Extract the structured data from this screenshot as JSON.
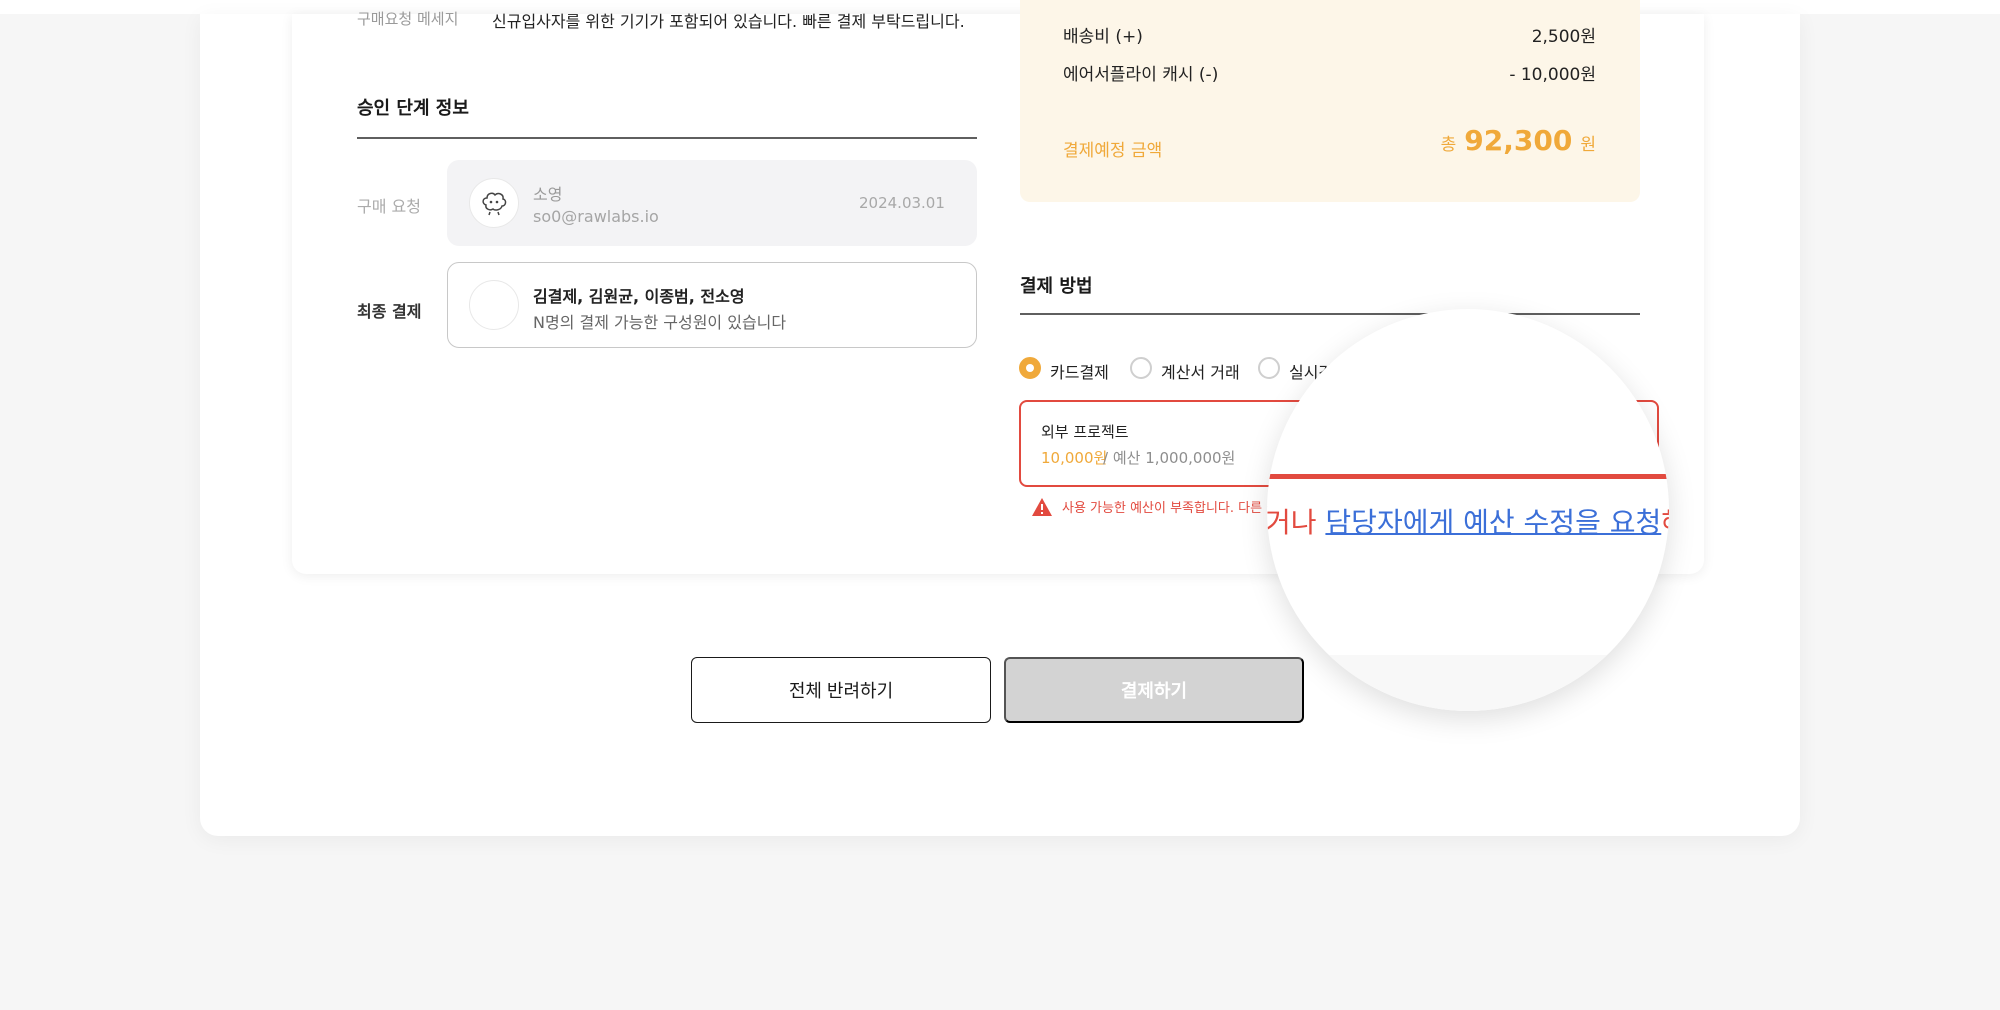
{
  "request_message": {
    "label": "구매요청 메세지",
    "text": "신규입사자를 위한 기기가 포함되어 있습니다. 빠른 결제 부탁드립니다."
  },
  "approval": {
    "title": "승인 단계 정보",
    "request": {
      "label": "구매 요청",
      "name": "소영",
      "email": "so0@rawlabs.io",
      "date": "2024.03.01"
    },
    "final": {
      "label": "최종 결제",
      "names": "김결제, 김원균, 이종범, 전소영",
      "description": "N명의 결제 가능한 구성원이 있습니다"
    }
  },
  "summary": {
    "rows": [
      {
        "label": "배송비 (+)",
        "value": "2,500원"
      },
      {
        "label": "에어서플라이 캐시 (-)",
        "value": "- 10,000원"
      }
    ],
    "total_label": "결제예정 금액",
    "total_prefix": "총",
    "total_amount": "92,300",
    "total_unit": "원"
  },
  "payment": {
    "title": "결제 방법",
    "options": [
      {
        "label": "카드결제",
        "checked": true
      },
      {
        "label": "계산서 거래",
        "checked": false
      },
      {
        "label": "실시간",
        "checked": false
      }
    ],
    "project": {
      "name": "외부 프로젝트",
      "amount": "10,000원",
      "budget": "/ 예산 1,000,000원"
    },
    "warning": "사용 가능한 예산이 부족합니다. 다른 결"
  },
  "magnifier": {
    "prefix": "거나 ",
    "link": "담당자에게 예산 수정을 요청",
    "suffix": "해주"
  },
  "buttons": {
    "reject": "전체 반려하기",
    "pay": "결제하기"
  },
  "colors": {
    "accent": "#f0a93a",
    "error": "#e24a3f",
    "link": "#3b6fd8",
    "disabled": "#d3d3d3"
  }
}
